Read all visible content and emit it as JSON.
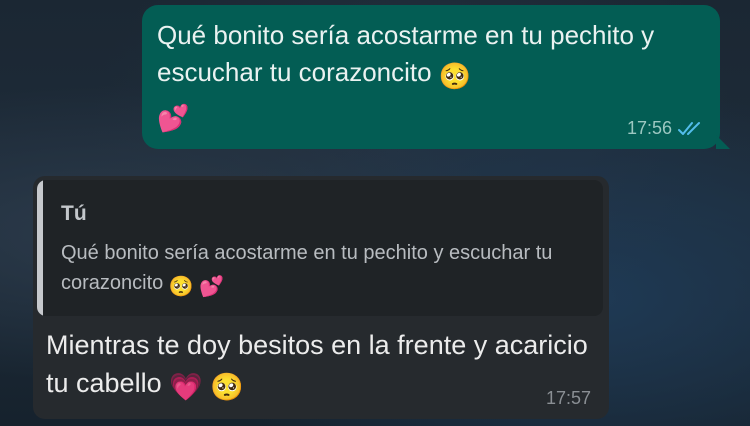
{
  "outgoing_message": {
    "text": "Qué bonito sería acostarme en tu pechito y escuchar tu corazoncito",
    "emoji_1": "🥺",
    "emoji_2": "💕",
    "time": "17:56",
    "status": "read",
    "tick_color": "#53bdeb"
  },
  "incoming_message": {
    "reply": {
      "author": "Tú",
      "text": "Qué bonito sería acostarme en tu pechito y escuchar tu corazoncito",
      "emoji_1": "🥺",
      "emoji_2": "💕"
    },
    "text": "Mientras te doy besitos en la frente y acaricio tu cabello",
    "emoji_1": "💗",
    "emoji_2": "🥺",
    "time": "17:57"
  },
  "colors": {
    "outgoing_bubble": "#035d54",
    "incoming_bubble": "#262a2e",
    "reply_quote_bg": "#1f2326"
  }
}
